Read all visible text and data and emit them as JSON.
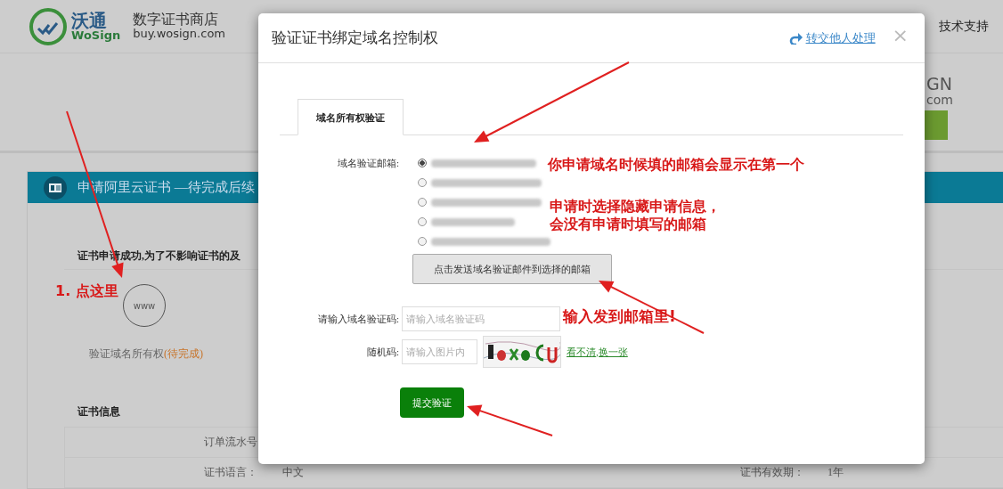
{
  "header": {
    "logo": {
      "name": "沃通",
      "latin": "WoSign"
    },
    "store_name": "数字证书商店",
    "store_domain": "buy.wosign.com",
    "nav_item": "技术支持"
  },
  "banner": {
    "brand_end": "GN",
    "domain_end": "com"
  },
  "panel": {
    "title": "申请阿里云证书 —待完成后续",
    "notice": "证书申请成功,为了不影响证书的及",
    "step": {
      "icon_text": "www",
      "label": "验证域名所有权",
      "status": "(待完成)"
    },
    "info_heading": "证书信息",
    "info_rows": [
      {
        "label": "订单流水号"
      },
      {
        "label": "证书语言：",
        "value": "中文",
        "label_2": "证书有效期：",
        "value_2": "1年"
      }
    ]
  },
  "modal": {
    "title": "验证证书绑定域名控制权",
    "handoff_link": "转交他人处理",
    "close": "×",
    "tabs": [
      {
        "label": "域名所有权验证",
        "selected": true
      }
    ],
    "email_label": "域名验证邮箱:",
    "email_options": [
      {
        "selected": true
      },
      {
        "selected": false
      },
      {
        "selected": false
      },
      {
        "selected": false
      },
      {
        "selected": false
      }
    ],
    "send_button": "点击发送域名验证邮件到选择的邮箱",
    "code_label": "请输入域名验证码:",
    "code_placeholder": "请输入域名验证码",
    "random_label": "随机码:",
    "random_placeholder": "请输入图片内",
    "refresh_link": "看不清,换一张",
    "submit_button": "提交验证"
  },
  "annotations": [
    {
      "text": "1. 点这里"
    },
    {
      "text": "你申请域名时候填的邮箱会显示在第一个"
    },
    {
      "text": "申请时选择隐藏申请信息，"
    },
    {
      "text": "会没有申请时填写的邮箱"
    },
    {
      "text": "输入发到邮箱里!"
    }
  ]
}
